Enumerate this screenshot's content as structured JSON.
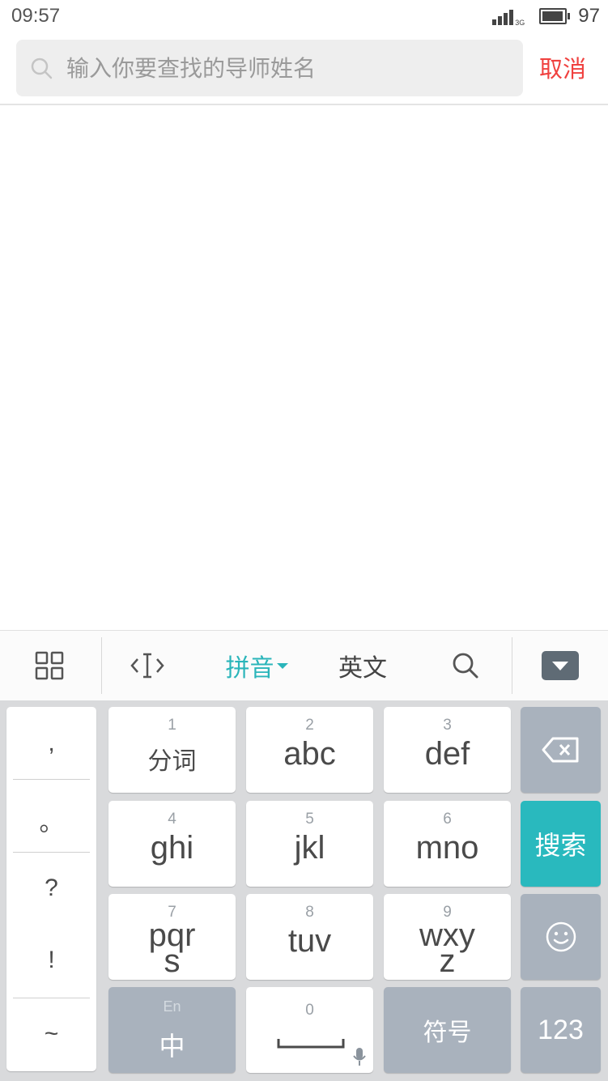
{
  "status_bar": {
    "time": "09:57",
    "network": "3G",
    "battery": "97",
    "battery_level": 0.97
  },
  "search": {
    "placeholder": "输入你要查找的导师姓名",
    "value": "",
    "cancel_label": "取消"
  },
  "keyboard": {
    "toolbar": {
      "pinyin_label": "拼音",
      "english_label": "英文"
    },
    "punctuation": [
      ",",
      "。",
      "?",
      "!",
      "~"
    ],
    "keys": [
      {
        "num": "1",
        "label": "分词"
      },
      {
        "num": "2",
        "label": "abc"
      },
      {
        "num": "3",
        "label": "def"
      },
      {
        "num": "4",
        "label": "ghi"
      },
      {
        "num": "5",
        "label": "jkl"
      },
      {
        "num": "6",
        "label": "mno"
      },
      {
        "num": "7",
        "label": "pqr",
        "label2": "s"
      },
      {
        "num": "8",
        "label": "tuv"
      },
      {
        "num": "9",
        "label": "wxy",
        "label2": "z"
      }
    ],
    "search_key": "搜索",
    "lang_key": {
      "top": "En",
      "label": "中"
    },
    "space_key": {
      "num": "0"
    },
    "symbols_key": "符号",
    "numbers_key": "123"
  },
  "colors": {
    "accent": "#2ab5ba",
    "cancel": "#f0413f",
    "key_gray": "#a9b2bd",
    "keyboard_bg": "#d9dadc"
  }
}
